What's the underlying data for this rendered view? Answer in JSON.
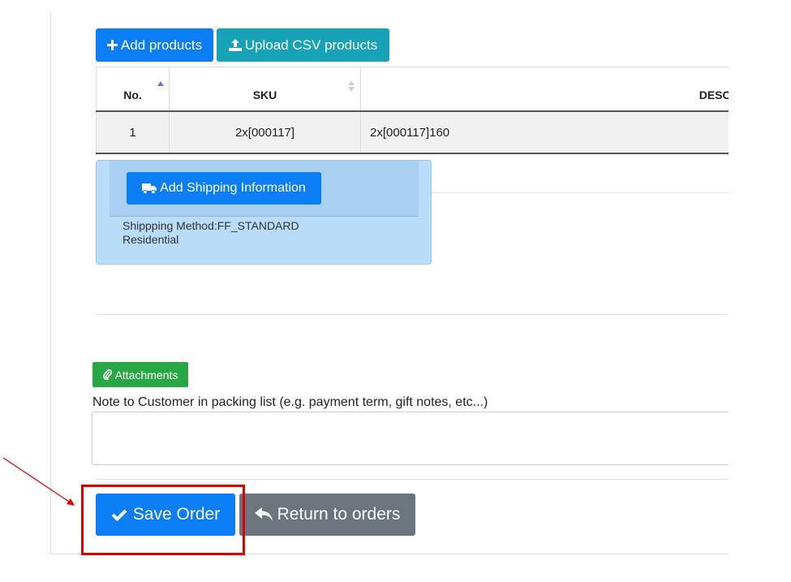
{
  "toolbar": {
    "add_products": "Add products",
    "upload_csv": "Upload CSV products"
  },
  "table": {
    "headers": {
      "no": "No.",
      "sku": "SKU",
      "description": "DESCRIP"
    },
    "rows": [
      {
        "no": "1",
        "sku": "2x[000117]",
        "description": "2x[000117]160"
      }
    ]
  },
  "shipping": {
    "button_label": "Add Shipping Information",
    "method_line": "Shippping Method:FF_STANDARD",
    "type_line": "Residential"
  },
  "attachments": {
    "label": "Attachments"
  },
  "note": {
    "label": "Note to Customer in packing list (e.g. payment term, gift notes, etc...)",
    "value": ""
  },
  "actions": {
    "save_order": "Save Order",
    "return_to_orders": "Return to orders"
  },
  "colors": {
    "primary": "#0b7ef6",
    "info": "#17a2b8",
    "success": "#28a745",
    "secondary": "#6c757d",
    "highlight": "#e00000"
  }
}
